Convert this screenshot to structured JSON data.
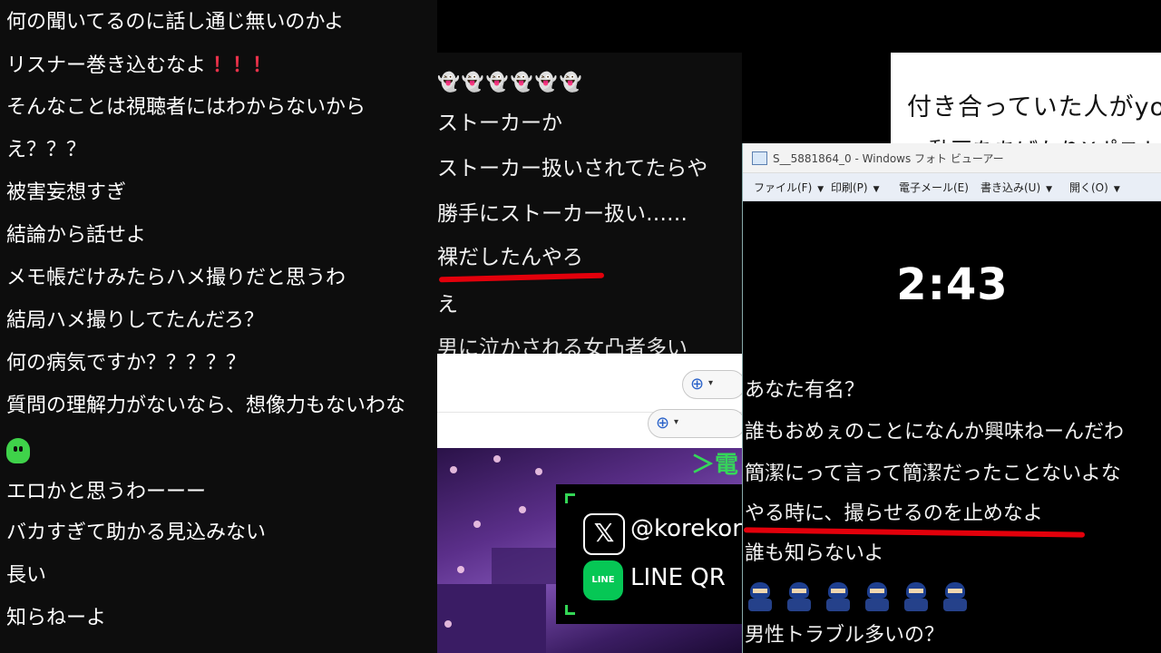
{
  "left_chat": {
    "lines": [
      "何の聞いてるのに話し通じ無いのかよ",
      "リスナー巻き込むなよ",
      "そんなことは視聴者にはわからないから",
      "え？？？",
      "被害妄想すぎ",
      "結論から話せよ",
      "メモ帳だけみたらハメ撮りだと思うわ",
      "結局ハメ撮りしてたんだろ？",
      "何の病気ですか？？？？？",
      "質問の理解力がないなら、想像力もないわな",
      "",
      "エロかと思うわーーー",
      "バカすぎて助かる見込みない",
      "長い",
      "知らねーよ"
    ],
    "exclaim": "！！！"
  },
  "mid_chat": {
    "ghost": "👻👻👻👻👻👻",
    "lines": [
      "ストーカーか",
      "ストーカー扱いされてたらや",
      "勝手にストーカー扱い……",
      "裸だしたんやろ",
      "え",
      "男に泣かされる女凸者多い"
    ]
  },
  "doc_top": {
    "line1": "付き合っていた人がyo",
    "line2": "動画をあげたりXポスト"
  },
  "viewer": {
    "title": "S__5881864_0 - Windows フォト ビューアー",
    "menu": [
      "ファイル(F)",
      "印刷(P)",
      "電子メール(E)",
      "書き込み(U)",
      "開く(O)"
    ],
    "clock": "2:43",
    "lines": [
      "あなた有名？",
      "誰もおめぇのことになんか興味ねーんだわ",
      "簡潔にって言って簡潔だったことないよな",
      "やる時に、撮らせるのを止めなよ",
      "誰も知らないよ",
      "",
      "男性トラブル多いの？"
    ]
  },
  "stream": {
    "arrow_text": "＞電",
    "x_handle": "@korekor",
    "line_label": "LINE",
    "line_text": "LINE QR"
  },
  "colors": {
    "underline": "#e3000b",
    "bang": "#e8324a",
    "accent_green": "#35d65a",
    "line_green": "#06c755"
  }
}
